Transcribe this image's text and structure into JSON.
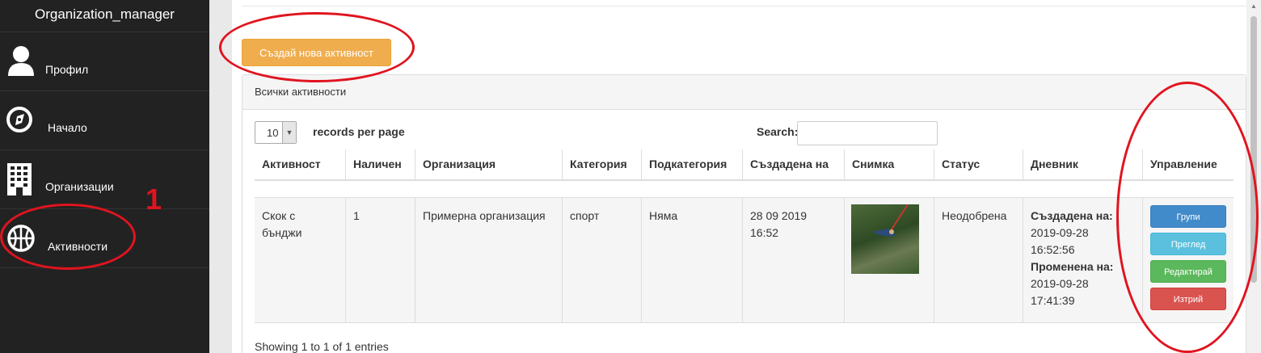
{
  "app": {
    "title": "Organization_manager"
  },
  "sidebar": {
    "items": [
      {
        "label": "Профил",
        "icon": "user-icon"
      },
      {
        "label": "Начало",
        "icon": "compass-icon"
      },
      {
        "label": "Организации",
        "icon": "building-icon"
      },
      {
        "label": "Активности",
        "icon": "basketball-icon"
      }
    ]
  },
  "annotation": {
    "marker": "1",
    "color": "#e0141f"
  },
  "main": {
    "create_button": "Създай нова активност",
    "panel_title": "Всички активности",
    "page_length": {
      "selected": "10",
      "label": "records per page"
    },
    "search": {
      "label": "Search:",
      "value": ""
    },
    "table": {
      "columns": [
        "Активност",
        "Наличен",
        "Организация",
        "Категория",
        "Подкатегория",
        "Създадена на",
        "Снимка",
        "Статус",
        "Дневник",
        "Управление"
      ],
      "rows": [
        {
          "activity": "Скок с бънджи",
          "available": "1",
          "organization": "Примерна организация",
          "category": "спорт",
          "subcategory": "Няма",
          "created": "28 09 2019 16:52",
          "status": "Неодобрена",
          "log": {
            "created_label": "Създадена на:",
            "created_value": "2019-09-28 16:52:56",
            "modified_label": "Променена на:",
            "modified_value": "2019-09-28 17:41:39"
          },
          "actions": [
            "Групи",
            "Преглед",
            "Редактирай",
            "Изтрий"
          ]
        }
      ]
    },
    "footer": "Showing 1 to 1 of 1 entries"
  },
  "colors": {
    "sidebar_bg": "#222222",
    "warning": "#f0ad4e",
    "primary": "#428bca",
    "info": "#5bc0de",
    "success": "#5cb85c",
    "danger": "#d9534f"
  }
}
